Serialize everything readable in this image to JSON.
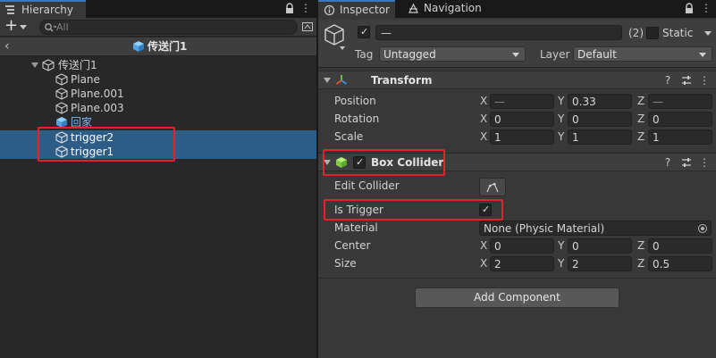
{
  "hierarchy": {
    "tab_label": "Hierarchy",
    "search_placeholder": "All",
    "scene_title": "传送门1",
    "tree": [
      {
        "label": "传送门1",
        "prefab": false
      },
      {
        "label": "Plane",
        "prefab": false
      },
      {
        "label": "Plane.001",
        "prefab": false
      },
      {
        "label": "Plane.003",
        "prefab": false
      },
      {
        "label": "回家",
        "prefab": true
      },
      {
        "label": "trigger2",
        "prefab": false,
        "selected": true
      },
      {
        "label": "trigger1",
        "prefab": false,
        "selected": true
      }
    ]
  },
  "inspector": {
    "tabs": [
      {
        "label": "Inspector"
      },
      {
        "label": "Navigation"
      }
    ],
    "object": {
      "name_value": "—",
      "multi_count": "(2)",
      "static_label": "Static",
      "tag_label": "Tag",
      "tag_value": "Untagged",
      "layer_label": "Layer",
      "layer_value": "Default"
    },
    "transform": {
      "title": "Transform",
      "rows": [
        {
          "label": "Position",
          "x": "—",
          "y": "0.33",
          "z": "—"
        },
        {
          "label": "Rotation",
          "x": "0",
          "y": "0",
          "z": "0"
        },
        {
          "label": "Scale",
          "x": "1",
          "y": "1",
          "z": "1"
        }
      ]
    },
    "box_collider": {
      "title": "Box Collider",
      "edit_collider_label": "Edit Collider",
      "is_trigger_label": "Is Trigger",
      "material_label": "Material",
      "material_value": "None (Physic Material)",
      "center": {
        "label": "Center",
        "x": "0",
        "y": "0",
        "z": "0"
      },
      "size": {
        "label": "Size",
        "x": "2",
        "y": "2",
        "z": "0.5"
      }
    },
    "axes": {
      "x": "X",
      "y": "Y",
      "z": "Z"
    },
    "add_component_label": "Add Component"
  },
  "colors": {
    "selection": "#2c5d87",
    "highlight_box": "#e8202a",
    "tab_accent": "#3a79bb",
    "prefab_text": "#7fb7ef"
  },
  "icons": [
    "hierarchy-icon",
    "lock-icon",
    "menu-icon",
    "plus-icon",
    "search-icon",
    "scene-icon",
    "prefab-icon",
    "gameobject-icon",
    "inspector-icon",
    "navigation-icon",
    "transform-icon",
    "box-collider-icon",
    "help-icon",
    "settings-icon",
    "more-icon",
    "object-picker-icon",
    "edit-collider-icon"
  ]
}
